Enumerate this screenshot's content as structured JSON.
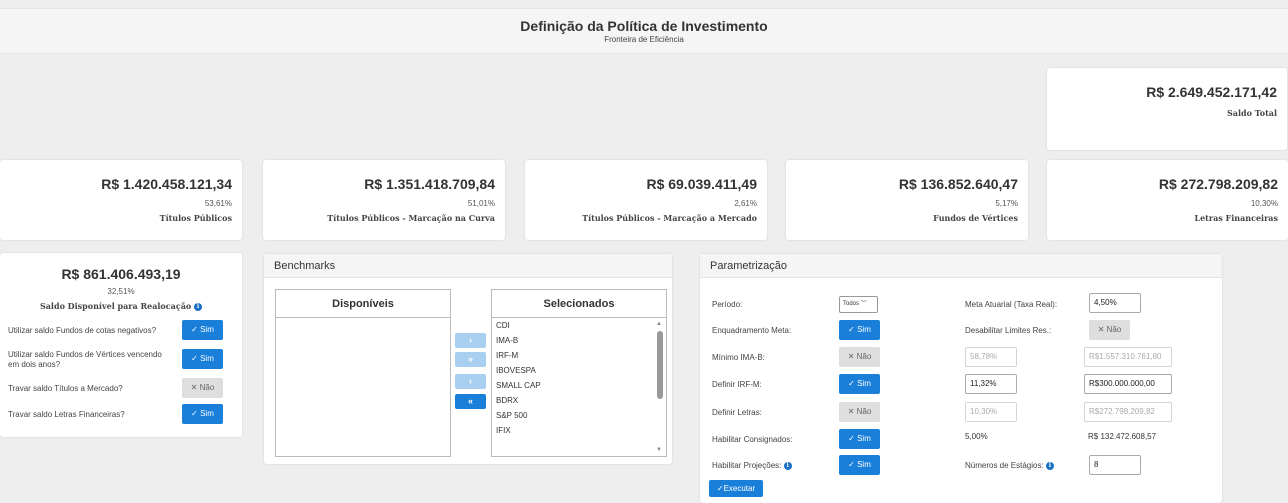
{
  "header": {
    "title": "Definição da Política de Investimento",
    "subtitle": "Fronteira de Eficiência"
  },
  "total": {
    "value": "R$ 2.649.452.171,42",
    "label": "Saldo Total"
  },
  "cards": [
    {
      "value": "R$ 1.420.458.121,34",
      "percent": "53,61%",
      "label": "Títulos Públicos"
    },
    {
      "value": "R$ 1.351.418.709,84",
      "percent": "51,01%",
      "label": "Títulos Públicos - Marcação na Curva"
    },
    {
      "value": "R$ 69.039.411,49",
      "percent": "2,61%",
      "label": "Títulos Públicos - Marcação a Mercado"
    },
    {
      "value": "R$ 136.852.640,47",
      "percent": "5,17%",
      "label": "Fundos de Vértices"
    },
    {
      "value": "R$ 272.798.209,82",
      "percent": "10,30%",
      "label": "Letras Financeiras"
    }
  ],
  "saldo": {
    "value": "R$ 861.406.493,19",
    "percent": "32,51%",
    "label": "Saldo Disponível para Realocação",
    "info_icon": "info-icon",
    "options": [
      {
        "label": "Utilizar saldo Fundos de cotas negativos?",
        "state": "Sim"
      },
      {
        "label": "Utilizar saldo Fundos de Vértices vencendo em dois anos?",
        "state": "Sim"
      },
      {
        "label": "Travar saldo Títulos a Mercado?",
        "state": "Não"
      },
      {
        "label": "Travar saldo Letras Financeiras?",
        "state": "Sim"
      }
    ]
  },
  "benchmarks": {
    "title": "Benchmarks",
    "available_header": "Disponíveis",
    "selected_header": "Selecionados",
    "available": [],
    "selected": [
      "CDI",
      "IMA-B",
      "IRF-M",
      "IBOVESPA",
      "SMALL CAP",
      "BDRX",
      "S&P 500",
      "IFIX"
    ],
    "move_buttons": [
      "›",
      "»",
      "‹",
      "«"
    ]
  },
  "param": {
    "title": "Parametrização",
    "periodo_label": "Período:",
    "periodo_value": "Todos",
    "enquadramento_label": "Enquadramento Meta:",
    "enquadramento_state": "Sim",
    "minimo_imab_label": "Mínimo IMA-B:",
    "minimo_imab_state": "Não",
    "minimo_imab_pct": "58,78%",
    "minimo_imab_amt": "R$1.557.310.761,80",
    "irfm_label": "Definir IRF-M:",
    "irfm_state": "Sim",
    "irfm_pct": "11,32%",
    "irfm_amt": "R$300.000.000,00",
    "letras_label": "Definir Letras:",
    "letras_state": "Não",
    "letras_pct": "10,30%",
    "letras_amt": "R$272.798.209,82",
    "consignados_label": "Habilitar Consignados:",
    "consignados_state": "Sim",
    "consignados_pct": "5,00%",
    "consignados_amt": "R$ 132.472.608,57",
    "projecoes_label": "Habilitar Projeções:",
    "projecoes_state": "Sim",
    "meta_label": "Meta Atuarial (Taxa Real):",
    "meta_value": "4,50%",
    "desabilitar_label": "Desabilitar Limites Res.:",
    "desabilitar_state": "Não",
    "estagios_label": "Números de Estágios:",
    "estagios_value": "8",
    "executar_label": "Executar"
  }
}
